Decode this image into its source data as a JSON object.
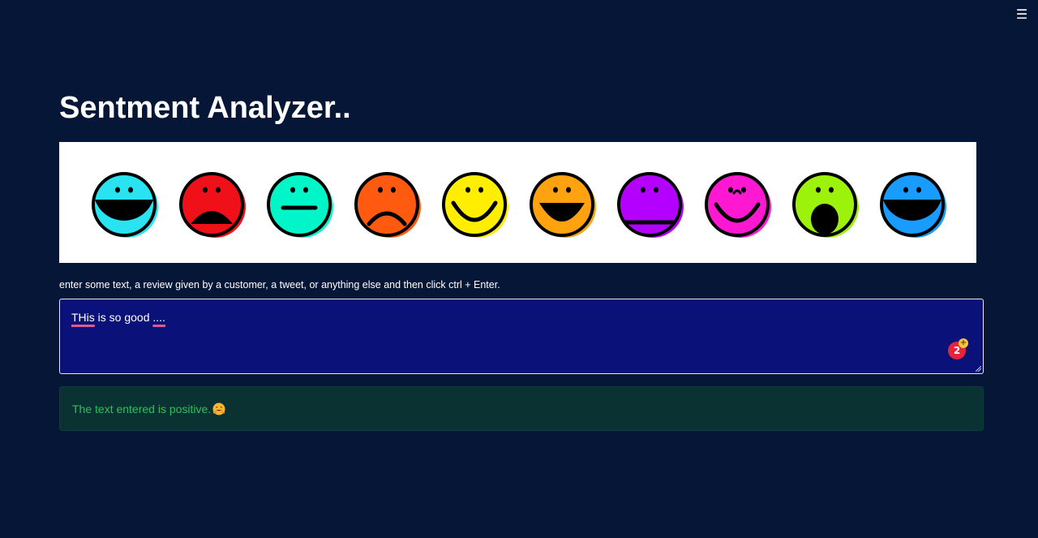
{
  "app": {
    "menu_icon": "hamburger-menu-icon",
    "menu_glyph": "☰"
  },
  "page": {
    "title": "Sentment Analyzer.."
  },
  "banner": {
    "image_name": "emoji-faces-banner",
    "faces": [
      {
        "expression": "open-mouth",
        "color": "#29e3f0"
      },
      {
        "expression": "sad-open",
        "color": "#f0101a"
      },
      {
        "expression": "neutral",
        "color": "#00f5c8"
      },
      {
        "expression": "sad",
        "color": "#ff5a10"
      },
      {
        "expression": "smile",
        "color": "#ffee00"
      },
      {
        "expression": "big-grin",
        "color": "#ffa210"
      },
      {
        "expression": "flat-smile",
        "color": "#b400ff"
      },
      {
        "expression": "wink-smile",
        "color": "#ff18d2"
      },
      {
        "expression": "surprised",
        "color": "#9cf20a"
      },
      {
        "expression": "open-mouth",
        "color": "#189cff"
      }
    ]
  },
  "input": {
    "label": "enter some text, a review given by a customer, a tweet, or anything else and then click ctrl + Enter.",
    "value_parts": [
      "THis",
      " is so good ",
      "...."
    ],
    "grammar_badge_count": "2",
    "grammar_badge_plus": "+"
  },
  "result": {
    "message": "The text entered is positive.",
    "emoji_icon": "hugging-face-icon"
  },
  "colors": {
    "background": "#061637",
    "textarea_bg": "#0a1178",
    "alert_bg": "#0b3233",
    "alert_text": "#27c25a",
    "badge_red": "#e3243b"
  }
}
